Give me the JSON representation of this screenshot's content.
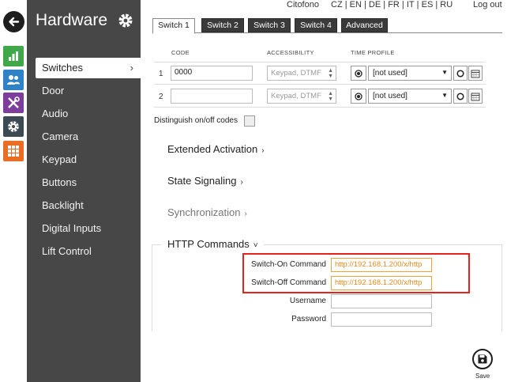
{
  "top_bar": {
    "app_link": "Citofono",
    "languages": [
      "CZ",
      "EN",
      "DE",
      "FR",
      "IT",
      "ES",
      "RU"
    ],
    "logout": "Log out"
  },
  "rail": {
    "icons": [
      "back-arrow-icon",
      "chart-icon",
      "users-icon",
      "tools-icon",
      "gear-icon",
      "grid-icon"
    ]
  },
  "sidebar": {
    "title": "Hardware",
    "items": [
      {
        "label": "Switches",
        "active": true
      },
      {
        "label": "Door"
      },
      {
        "label": "Audio"
      },
      {
        "label": "Camera"
      },
      {
        "label": "Keypad"
      },
      {
        "label": "Buttons"
      },
      {
        "label": "Backlight"
      },
      {
        "label": "Digital Inputs"
      },
      {
        "label": "Lift Control"
      }
    ],
    "active_chevron": "›"
  },
  "tabs": [
    "Switch 1",
    "Switch 2",
    "Switch 3",
    "Switch 4",
    "Advanced"
  ],
  "switch_table": {
    "headers": {
      "code": "CODE",
      "accessibility": "ACCESSIBILITY",
      "time_profile": "TIME PROFILE"
    },
    "rows": [
      {
        "num": "1",
        "code": "0000",
        "accessibility": "Keypad, DTMF",
        "time_profile": "[not used]"
      },
      {
        "num": "2",
        "code": "",
        "accessibility": "Keypad, DTMF",
        "time_profile": "[not used]"
      }
    ]
  },
  "distinguish_label": "Distinguish on/off codes",
  "sections": {
    "extended_activation": "Extended Activation",
    "state_signaling": "State Signaling",
    "synchronization": "Synchronization",
    "http_commands": "HTTP Commands",
    "chevron_right": "›",
    "chevron_down": "˅"
  },
  "http": {
    "switch_on_label": "Switch-On Command",
    "switch_on_value": "http://192.168.1.200/x/http",
    "switch_off_label": "Switch-Off Command",
    "switch_off_value": "http://192.168.1.200/x/http",
    "username_label": "Username",
    "username_value": "",
    "password_label": "Password",
    "password_value": ""
  },
  "save_label": "Save",
  "colors": {
    "sidebar_bg": "#474747",
    "tab_bg": "#3a3a3a",
    "rail_green": "#41a84a",
    "rail_blue": "#2f82c6",
    "rail_purple": "#7d3d9c",
    "rail_slate": "#3c4a53",
    "rail_orange": "#e96d25",
    "highlight_red": "#e5231b",
    "url_orange": "#e58a1f"
  }
}
